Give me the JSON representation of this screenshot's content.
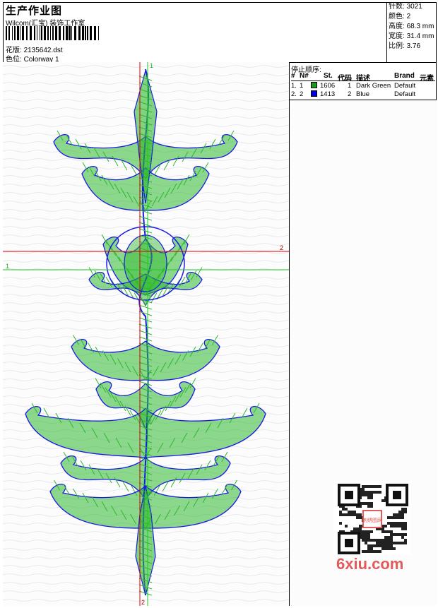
{
  "header": {
    "title": "生产作业图",
    "subtitle": "Wilcom(汇宝) 装饰工作室",
    "file_label": "花版:",
    "file_value": "2135642.dst",
    "colorway_label": "色位:",
    "colorway_value": "Colorway 1"
  },
  "stats": [
    {
      "label": "针数:",
      "value": "3021"
    },
    {
      "label": "颜色:",
      "value": "2"
    },
    {
      "label": "高度:",
      "value": "68.3 mm"
    },
    {
      "label": "宽度:",
      "value": "31.4 mm"
    },
    {
      "label": "比例:",
      "value": "3.76"
    }
  ],
  "stop_sequence": {
    "title": "停止顺序:",
    "columns": [
      "#",
      "N#",
      "St.",
      "代码",
      "描述",
      "Brand",
      "元素"
    ],
    "rows": [
      {
        "index": "1.",
        "n": "1",
        "stitches": "1606",
        "code": "1",
        "description": "Dark Green",
        "brand": "Default",
        "color": "#1a9a1a"
      },
      {
        "index": "2.",
        "n": "2",
        "stitches": "1413",
        "code": "2",
        "description": "Blue",
        "brand": "Default",
        "color": "#0000e0"
      }
    ]
  },
  "guides": {
    "vertical_top_label": "1",
    "vertical_bottom_label": "2",
    "horizontal_red_label": "2",
    "horizontal_green_label": "1",
    "red_color": "#e00000",
    "green_color": "#22cc22"
  },
  "design_colors": {
    "green": "#2eb82e",
    "blue": "#1a1ae6"
  },
  "watermark": {
    "text": "6xiu.com",
    "qr_badge": "刺绣图网"
  }
}
